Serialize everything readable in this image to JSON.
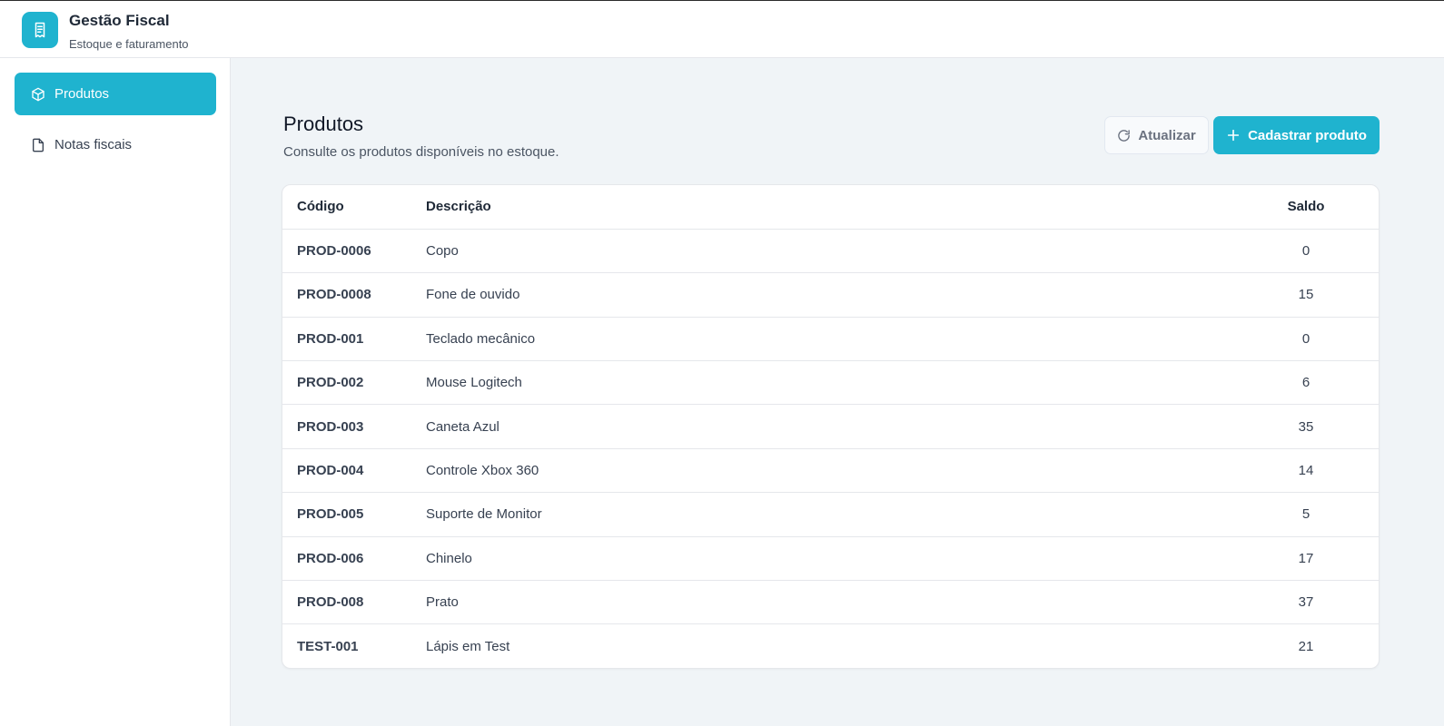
{
  "header": {
    "title": "Gestão Fiscal",
    "subtitle": "Estoque e faturamento",
    "logo_icon": "receipt-icon"
  },
  "sidebar": {
    "items": [
      {
        "label": "Produtos",
        "icon": "box-icon",
        "active": true
      },
      {
        "label": "Notas fiscais",
        "icon": "file-icon",
        "active": false
      }
    ]
  },
  "page": {
    "title": "Produtos",
    "subtitle": "Consulte os produtos disponíveis no estoque.",
    "refresh_label": "Atualizar",
    "add_label": "Cadastrar produto"
  },
  "table": {
    "headers": {
      "code": "Código",
      "description": "Descrição",
      "balance": "Saldo"
    },
    "rows": [
      {
        "code": "PROD-0006",
        "description": "Copo",
        "balance": "0"
      },
      {
        "code": "PROD-0008",
        "description": "Fone de ouvido",
        "balance": "15"
      },
      {
        "code": "PROD-001",
        "description": "Teclado mecânico",
        "balance": "0"
      },
      {
        "code": "PROD-002",
        "description": "Mouse Logitech",
        "balance": "6"
      },
      {
        "code": "PROD-003",
        "description": "Caneta Azul",
        "balance": "35"
      },
      {
        "code": "PROD-004",
        "description": "Controle Xbox 360",
        "balance": "14"
      },
      {
        "code": "PROD-005",
        "description": "Suporte de Monitor",
        "balance": "5"
      },
      {
        "code": "PROD-006",
        "description": "Chinelo",
        "balance": "17"
      },
      {
        "code": "PROD-008",
        "description": "Prato",
        "balance": "37"
      },
      {
        "code": "TEST-001",
        "description": "Lápis em Test",
        "balance": "21"
      }
    ]
  },
  "colors": {
    "accent": "#1fb3cf",
    "background": "#f0f4f7"
  }
}
